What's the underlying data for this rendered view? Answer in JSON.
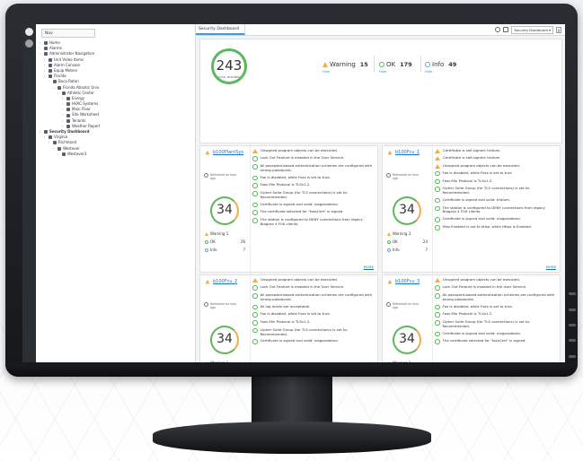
{
  "nav": {
    "tab_label": "Nav",
    "tree": [
      {
        "label": "Home",
        "indent": 0
      },
      {
        "label": "Alarms",
        "indent": 0
      },
      {
        "label": "Administrator Navigation",
        "indent": 0
      },
      {
        "label": "Unit Video Items",
        "indent": 1
      },
      {
        "label": "Alarm Console",
        "indent": 1
      },
      {
        "label": "Equip Meters",
        "indent": 1
      },
      {
        "label": "Florida",
        "indent": 1
      },
      {
        "label": "Boca Raton",
        "indent": 2
      },
      {
        "label": "Florida Atlantic Univ",
        "indent": 3
      },
      {
        "label": "Athletic Center",
        "indent": 4
      },
      {
        "label": "Energy",
        "indent": 5
      },
      {
        "label": "HVAC Systems",
        "indent": 5
      },
      {
        "label": "Main Floor",
        "indent": 5
      },
      {
        "label": "Site Worksheet",
        "indent": 5
      },
      {
        "label": "Tenants",
        "indent": 5
      },
      {
        "label": "Weather Report",
        "indent": 5
      },
      {
        "label": "Security Dashboard",
        "indent": 0,
        "selected": true
      },
      {
        "label": "Virginia",
        "indent": 1
      },
      {
        "label": "Richmond",
        "indent": 2
      },
      {
        "label": "Westover",
        "indent": 3
      },
      {
        "label": "Westover3",
        "indent": 4
      }
    ]
  },
  "main": {
    "tab_label": "Security Dashboard",
    "dashboard_select": "Security Dashboard ▾",
    "close": "X"
  },
  "summary": {
    "total": "243",
    "total_label": "TOTAL FEATURES",
    "warning_label": "Warning",
    "warning_count": "15",
    "ok_label": "OK",
    "ok_count": "179",
    "info_label": "Info",
    "info_count": "49",
    "hide": "Hide"
  },
  "cards": [
    {
      "name": "b100PlantSys",
      "refreshed": "Refreshed an hour ago",
      "score": "34",
      "warning": "1",
      "ok": "26",
      "info": "7",
      "messages": [
        {
          "t": "w",
          "text": "Unsigned program objects can be executed."
        },
        {
          "t": "o",
          "text": "Lock Out Feature is enabled in the User Service."
        },
        {
          "t": "o",
          "text": "All password-based authentication schemes are configured with strong passwords."
        },
        {
          "t": "o",
          "text": "Fox is disabled, while Foxs is set to true."
        },
        {
          "t": "o",
          "text": "Foxs Min Protocol is TLSv1.2."
        },
        {
          "t": "o",
          "text": "Cipher Suite Group (for TLS connections) is set to: Recommended."
        },
        {
          "t": "o",
          "text": "Certificate is signed and valid: niagarademo."
        },
        {
          "t": "o",
          "text": "The certificate selected for \"foxsCert\" is signed."
        },
        {
          "t": "o",
          "text": "The station is configured to DENY connections from legacy Niagara 4 FOX clients."
        }
      ],
      "more": "MORE"
    },
    {
      "name": "b100Fcu_1",
      "refreshed": "Refreshed an hour ago",
      "score": "34",
      "warning": "3",
      "ok": "24",
      "info": "7",
      "messages": [
        {
          "t": "w",
          "text": "Certificate is self-signed: tridium."
        },
        {
          "t": "w",
          "text": "Certificate is self-signed: tridium."
        },
        {
          "t": "w",
          "text": "Unsigned program objects can be executed."
        },
        {
          "t": "o",
          "text": "Fox is disabled, while Foxs is set to true."
        },
        {
          "t": "o",
          "text": "Foxs Min Protocol is TLSv1.2."
        },
        {
          "t": "o",
          "text": "Cipher Suite Group (for TLS connections) is set to: Recommended."
        },
        {
          "t": "o",
          "text": "Certificate is signed and valid: tridium."
        },
        {
          "t": "o",
          "text": "The station is configured to DENY connections from legacy Niagara 4 FOX clients."
        },
        {
          "t": "o",
          "text": "Certificate is signed and valid: niagarademo."
        },
        {
          "t": "o",
          "text": "Http Enabled is set to false, while Https is Enabled."
        }
      ],
      "more": "MORE"
    },
    {
      "name": "b100Fcu_2",
      "refreshed": "Refreshed an hour ago",
      "score": "34",
      "warning": "1",
      "ok": "",
      "info": "",
      "messages": [
        {
          "t": "w",
          "text": "Unsigned program objects can be executed."
        },
        {
          "t": "o",
          "text": "Lock Out Feature is enabled in the User Service."
        },
        {
          "t": "o",
          "text": "All password-based authentication schemes are configured with strong passwords."
        },
        {
          "t": "o",
          "text": "All log levels are acceptable."
        },
        {
          "t": "o",
          "text": "Fox is disabled, while Foxs is set to true."
        },
        {
          "t": "o",
          "text": "Foxs Min Protocol is TLSv1.2."
        },
        {
          "t": "o",
          "text": "Cipher Suite Group (for TLS connections) is set to: Recommended."
        },
        {
          "t": "o",
          "text": "Certificate is signed and valid: niagarademo."
        }
      ],
      "more": ""
    },
    {
      "name": "b100Fcu_3",
      "refreshed": "Refreshed an hour ago",
      "score": "34",
      "warning": "1",
      "ok": "",
      "info": "",
      "messages": [
        {
          "t": "w",
          "text": "Unsigned program objects can be executed."
        },
        {
          "t": "o",
          "text": "Lock Out Feature is enabled in the User Service."
        },
        {
          "t": "o",
          "text": "All password-based authentication schemes are configured with strong passwords."
        },
        {
          "t": "o",
          "text": "Fox is disabled, while Foxs is set to true."
        },
        {
          "t": "o",
          "text": "Foxs Min Protocol is TLSv1.2."
        },
        {
          "t": "o",
          "text": "Cipher Suite Group (for TLS connections) is set to: Recommended."
        },
        {
          "t": "o",
          "text": "Certificate is signed and valid: niagarademo."
        },
        {
          "t": "o",
          "text": "The certificate selected for \"foxsCert\" is signed."
        }
      ],
      "more": ""
    }
  ]
}
